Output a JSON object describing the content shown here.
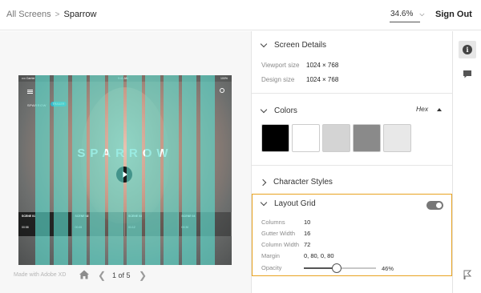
{
  "breadcrumb": {
    "root": "All Screens",
    "separator": ">",
    "current": "Sparrow"
  },
  "header": {
    "zoom": "34.6%",
    "sign_out": "Sign Out"
  },
  "artboard": {
    "status_left": "•••• Carrier",
    "status_center": "9:41 AM",
    "status_right": "100%",
    "title": "SPARROW",
    "brand": "SPARROW",
    "pill": "TRAILER",
    "scenes": [
      {
        "num": "SCENE 01",
        "time": "00:58"
      },
      {
        "num": "SCENE 02",
        "time": "00:45"
      },
      {
        "num": "SCENE 03",
        "time": "01:12"
      },
      {
        "num": "SCENE 04",
        "time": "00:30"
      }
    ]
  },
  "canvas_footer": {
    "made_with": "Made with Adobe XD",
    "page": "1 of 5"
  },
  "screen_details": {
    "title": "Screen Details",
    "viewport_label": "Viewport size",
    "viewport_value": "1024 × 768",
    "design_label": "Design size",
    "design_value": "1024 × 768"
  },
  "colors": {
    "title": "Colors",
    "format": "Hex",
    "swatches": [
      "#000000",
      "#ffffff",
      "#d4d4d4",
      "#8a8a8a",
      "#e8e8e8"
    ]
  },
  "character_styles": {
    "title": "Character Styles"
  },
  "layout_grid": {
    "title": "Layout Grid",
    "enabled": true,
    "columns_label": "Columns",
    "columns_value": "10",
    "gutter_label": "Gutter Width",
    "gutter_value": "16",
    "colwidth_label": "Column Width",
    "colwidth_value": "72",
    "margin_label": "Margin",
    "margin_value": "0, 80, 0, 80",
    "opacity_label": "Opacity",
    "opacity_value": "46%",
    "opacity_fraction": 0.46,
    "grid_color": "#5cded0"
  },
  "accent_color": "#e8a321"
}
